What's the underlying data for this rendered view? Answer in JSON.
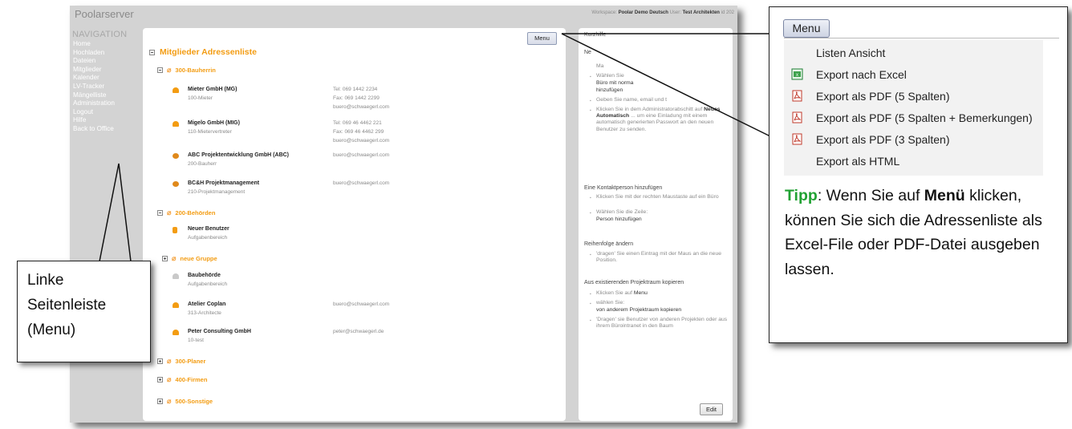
{
  "app": {
    "title": "Poolarserver",
    "workspace_label": "Workspace:",
    "workspace_value": "Poolar Demo Deutsch",
    "user_label": "User:",
    "user_value": "Test Architekten",
    "id_text": "id 202",
    "nav_heading": "NAVIGATION",
    "nav_items": [
      "Home",
      "Hochladen",
      "Dateien",
      "Mitglieder",
      "Kalender",
      "LV-Tracker",
      "Mängelliste",
      "Administration",
      "Logout",
      "Hilfe",
      "Back to Office"
    ]
  },
  "panel": {
    "menu_button": "Menu",
    "title": "Mitglieder Adressenliste",
    "groups": [
      "300-Bauherrin",
      "200-Behörden",
      "neue Gruppe",
      "300-Planer",
      "400-Firmen",
      "500-Sonstige"
    ],
    "entries": [
      {
        "name": "Mieter GmbH (MG)",
        "sub": "100-Mieter",
        "c1": "Tel: 069 1442 2234",
        "c2": "Fax: 069 1442 2299",
        "c3": "buero@schwaegerl.com"
      },
      {
        "name": "Migelo GmbH (MIG)",
        "sub": "110-Mietervertreter",
        "c1": "Tel: 069 46 4462 221",
        "c2": "Fax: 069 46 4462 299",
        "c3": "buero@schwaegerl.com"
      },
      {
        "name": "ABC Projektentwicklung GmbH (ABC)",
        "sub": "200-Bauherr",
        "c1": "buero@schwaegerl.com"
      },
      {
        "name": "BC&H Projektmanagement",
        "sub": "210-Projektmanagement",
        "c1": "buero@schwaegerl.com"
      },
      {
        "name": "Neuer Benutzer",
        "sub": "Aufgabenbereich"
      },
      {
        "name": "Baubehörde",
        "sub": "Aufgabenbereich"
      },
      {
        "name": "Atelier Coplan",
        "sub": "313-Architecte",
        "c1": "buero@schwaegerl.com"
      },
      {
        "name": "Peter Consulting GmbH",
        "sub": "10-test",
        "c1": "peter@schwaegerl.de"
      }
    ]
  },
  "help": {
    "title": "Kurzhilfe",
    "intro": "Ne",
    "s1_lines": [
      "Ma",
      "Wählen Sie",
      "Büro mit norma",
      "hinzufügen",
      "Geben Sie name, email und t"
    ],
    "s1_admin": "Klicken Sie in dem Administratorabschitt auf",
    "s1_admin_bold": "Neues Automatisch",
    "s1_admin_rest": "... um eine Einladung mit einem automatisch generierten Passwort an den neuen Benutzer zu senden.",
    "s2_heading": "Eine Kontaktperson hinzufügen",
    "s2_b1": "Klicken Sie mit der rechten Maustaste auf ein Büro",
    "s2_b2": "Wählen Sie die Zeile:",
    "s2_b2_value": "Person hinzufügen",
    "s3_heading": "Reihenfolge ändern",
    "s3_b1": "'dragen' Sie einen Eintrag mit der Maus an die neue Position.",
    "s4_heading": "Aus existierenden Projektraum kopieren",
    "s4_b1": "Klicken Sie auf",
    "s4_b1_value": "Menu",
    "s4_b2": "wählen Sie:",
    "s4_b2_value": "von anderem Projektraum kopieren",
    "s4_b3": "'Dragen' sie Benutzer von anderen Projekten oder aus ihrem Büroіntranet in den Baum",
    "edit_button": "Edit"
  },
  "callout_left": {
    "lines": [
      "Linke",
      "Seitenleiste",
      "(Menu)"
    ]
  },
  "callout_right": {
    "menu_button": "Menu",
    "menu_items": [
      "Listen Ansicht",
      "Export nach Excel",
      "Export als PDF (5 Spalten)",
      "Export als PDF (5 Spalten + Bemerkungen)",
      "Export als PDF (3 Spalten)",
      "Export als HTML"
    ],
    "tipp_label": "Tipp",
    "tipp_text1": ": Wenn Sie auf ",
    "tipp_bold": "Menü",
    "tipp_text2": " klicken, können Sie sich die Adressenliste als Excel-File oder PDF-Datei ausgeben lassen."
  },
  "colors": {
    "accent": "#f39c12",
    "tipp": "#21a233",
    "excel": "#1e7e34",
    "pdf": "#c0392b"
  }
}
